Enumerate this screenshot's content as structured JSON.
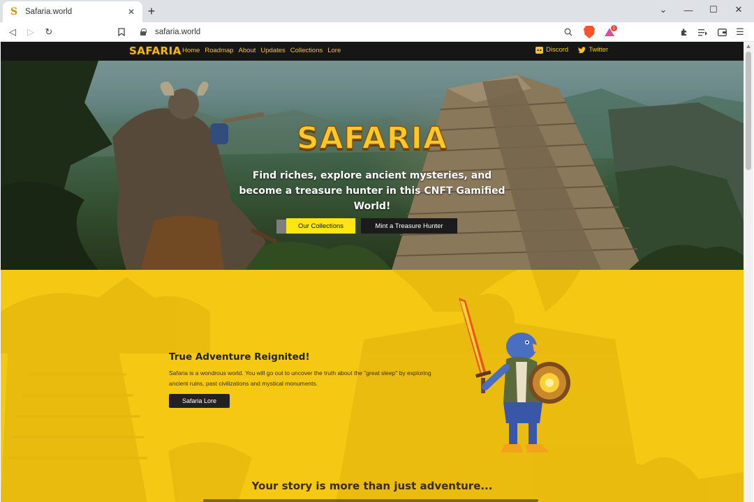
{
  "browser": {
    "tab_title": "Safaria.world",
    "new_tab_symbol": "+",
    "url": "safaria.world",
    "window_controls": [
      "minimize",
      "maximize",
      "close"
    ]
  },
  "site": {
    "logo": "SAFARIA",
    "nav_links": [
      "Home",
      "Roadmap",
      "About",
      "Updates",
      "Collections",
      "Lore"
    ],
    "social_links": [
      "Discord",
      "Twitter"
    ]
  },
  "hero": {
    "title": "SAFARIA",
    "subtitle": "Find riches, explore ancient mysteries, and become a treasure hunter in this CNFT Gamified World!",
    "primary_button": "Our Collections",
    "secondary_button": "Mint a Treasure Hunter"
  },
  "adventure": {
    "title": "True Adventure Reignited!",
    "body": "Safaria is a wondrous world. You will go out to uncover the truth about the \"great sleep\" by exploring ancient ruins, past civilizations and mystical monuments.",
    "button": "Safaria Lore"
  },
  "story": {
    "title": "Your story is more than just adventure..."
  },
  "colors": {
    "brand_yellow": "#f5c814",
    "button_yellow": "#fde612",
    "nav_bg": "#161616",
    "logo_gold": "#fbc82a"
  }
}
